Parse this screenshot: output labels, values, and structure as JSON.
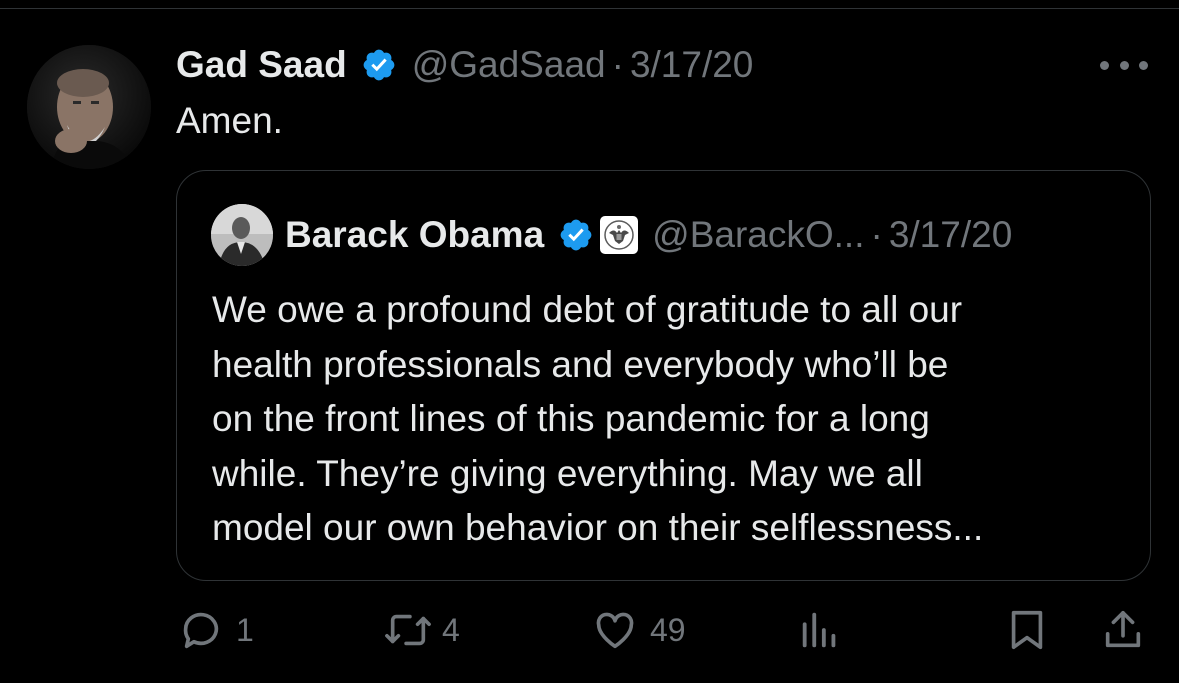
{
  "tweet": {
    "author_name": "Gad Saad",
    "handle": "@GadSaad",
    "separator": "·",
    "date": "3/17/20",
    "text": "Amen.",
    "avatar_icon": "author-avatar-photo",
    "verified_color": "#1d9bf0"
  },
  "quoted_tweet": {
    "author_name": "Barack Obama",
    "handle": "@BarackO...",
    "separator": "·",
    "date": "3/17/20",
    "lines": [
      "We owe a profound debt of gratitude to all our",
      "health professionals and everybody who’ll be",
      "on the front lines of this pandemic for a long",
      "while. They’re giving everything. May we all",
      "model our own behavior on their selflessness..."
    ],
    "affiliation_icon": "government-seal-icon"
  },
  "actions": {
    "reply_count": "1",
    "retweet_count": "4",
    "like_count": "49"
  },
  "colors": {
    "background": "#000000",
    "text_primary": "#e7e9ea",
    "text_secondary": "#71767b",
    "border": "#2f3336",
    "verified": "#1d9bf0"
  }
}
